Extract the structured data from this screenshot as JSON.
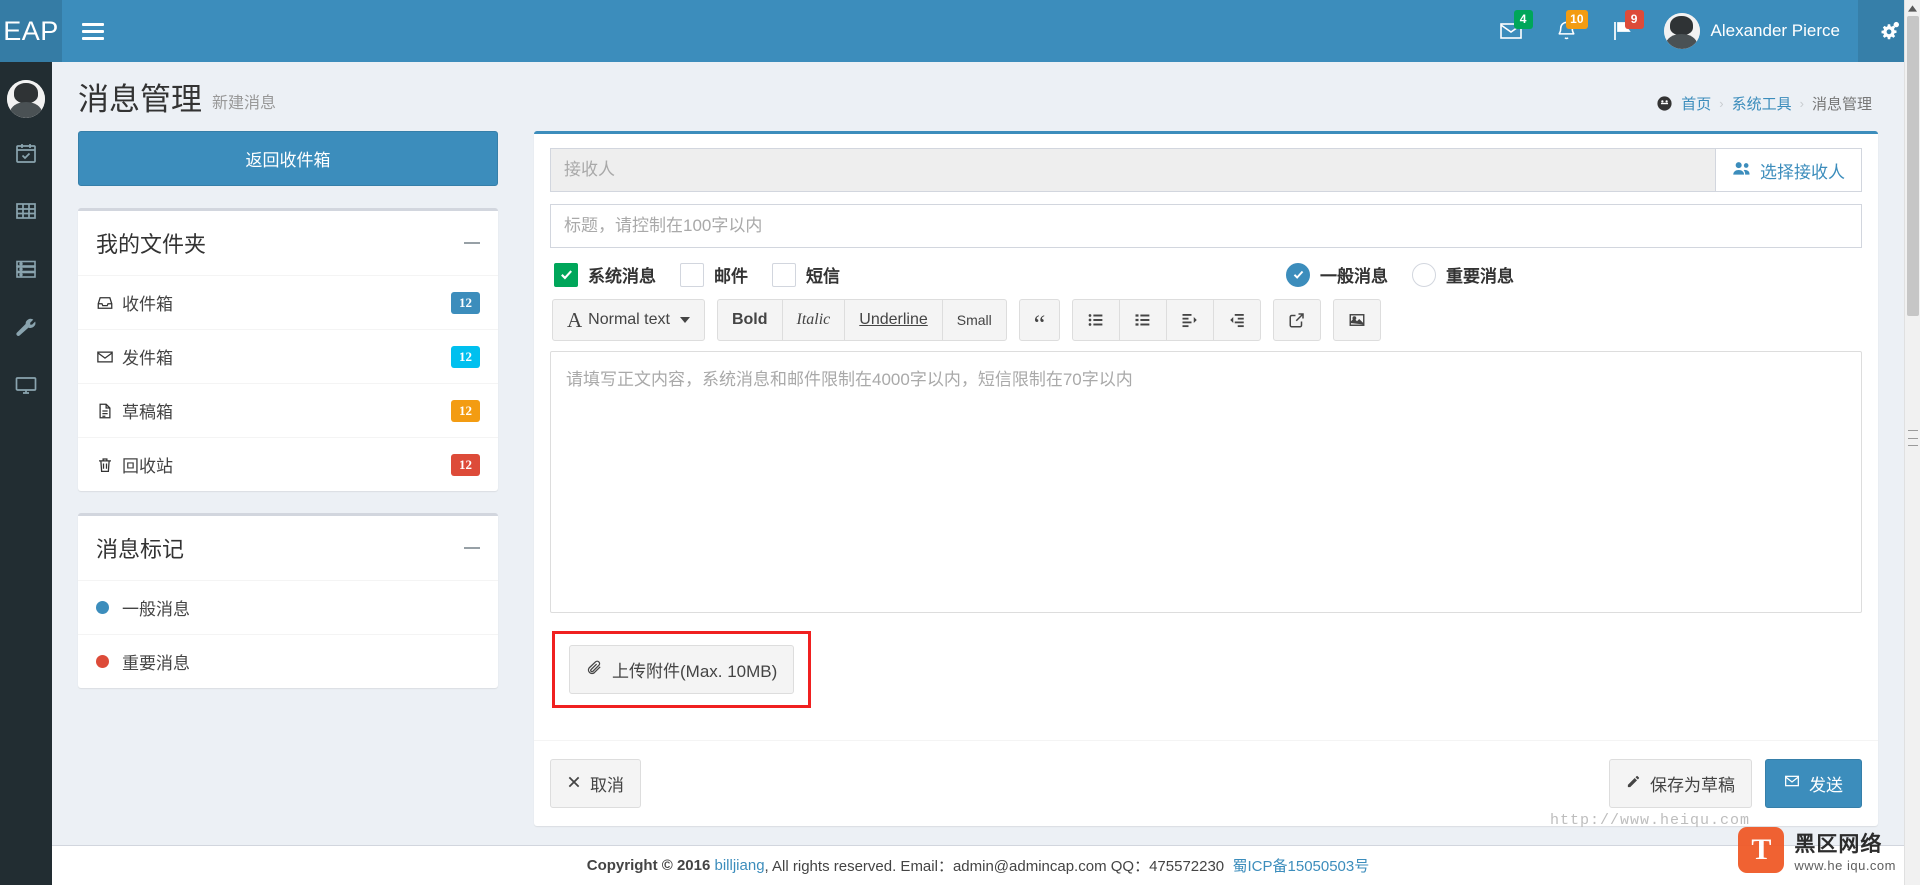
{
  "navbar": {
    "logo": "EAP",
    "toggle_icon": "hamburger-icon",
    "items": [
      {
        "icon": "envelope-icon",
        "badge": "4",
        "badge_color": "#00a65a"
      },
      {
        "icon": "bell-icon",
        "badge": "10",
        "badge_color": "#f39c12"
      },
      {
        "icon": "flag-icon",
        "badge": "9",
        "badge_color": "#dd4b39"
      }
    ],
    "user_name": "Alexander Pierce",
    "settings_icon": "gears-icon"
  },
  "rail": {
    "items": [
      "calendar-check-icon",
      "table-icon",
      "server-icon",
      "wrench-icon",
      "desktop-icon"
    ]
  },
  "page": {
    "title": "消息管理",
    "subtitle": "新建消息"
  },
  "breadcrumb": {
    "home_icon": "dashboard-icon",
    "items": [
      {
        "label": "首页",
        "active": false
      },
      {
        "label": "系统工具",
        "active": false
      },
      {
        "label": "消息管理",
        "active": true
      }
    ],
    "separator": "›"
  },
  "sidebar": {
    "back_button": "返回收件箱",
    "folders_title": "我的文件夹",
    "folders": [
      {
        "label": "收件箱",
        "icon": "inbox-icon",
        "badge": "12",
        "badge_class": "bg-primary"
      },
      {
        "label": "发件箱",
        "icon": "envelope-icon",
        "badge": "12",
        "badge_class": "bg-info"
      },
      {
        "label": "草稿箱",
        "icon": "file-text-icon",
        "badge": "12",
        "badge_class": "bg-warning"
      },
      {
        "label": "回收站",
        "icon": "trash-icon",
        "badge": "12",
        "badge_class": "bg-danger"
      }
    ],
    "labels_title": "消息标记",
    "labels": [
      {
        "label": "一般消息",
        "color": "#3c8dbc"
      },
      {
        "label": "重要消息",
        "color": "#dd4b39"
      }
    ]
  },
  "compose": {
    "recipient_placeholder": "接收人",
    "recipient_value": "",
    "choose_recipient_button": "选择接收人",
    "choose_recipient_icon": "users-icon",
    "subject_placeholder": "标题，请控制在100字以内",
    "subject_value": "",
    "channels": [
      {
        "label": "系统消息",
        "checked": true
      },
      {
        "label": "邮件",
        "checked": false
      },
      {
        "label": "短信",
        "checked": false
      }
    ],
    "priorities": [
      {
        "label": "一般消息",
        "checked": true
      },
      {
        "label": "重要消息",
        "checked": false
      }
    ],
    "toolbar": {
      "style_label": "Normal text",
      "bold": "Bold",
      "italic": "Italic",
      "underline": "Underline",
      "small": "Small",
      "quote_icon": "blockquote-icon",
      "ul_icon": "unordered-list-icon",
      "ol_icon": "ordered-list-icon",
      "indent_icon": "indent-icon",
      "outdent_icon": "outdent-icon",
      "link_icon": "link-share-icon",
      "image_icon": "image-icon"
    },
    "body_placeholder": "请填写正文内容，系统消息和邮件限制在4000字以内，短信限制在70字以内",
    "body_value": "",
    "attach_button": "上传附件(Max. 10MB)",
    "attach_icon": "paperclip-icon",
    "attach_highlight_color": "#f02020",
    "cancel_button": "取消",
    "cancel_icon": "times-icon",
    "draft_button": "保存为草稿",
    "draft_icon": "pencil-icon",
    "send_button": "发送",
    "send_icon": "envelope-icon"
  },
  "footer": {
    "copyright": "Copyright © 2016",
    "brand": "billjiang",
    "rights": ", All rights reserved. Email：admin@admincap.com QQ：475572230",
    "icp": "蜀ICP备15050503号"
  },
  "watermark": {
    "logo_letter": "T",
    "title": "黑区网络",
    "url": "www.he iqu.com",
    "top_url": "http://www.heiqu.com"
  }
}
